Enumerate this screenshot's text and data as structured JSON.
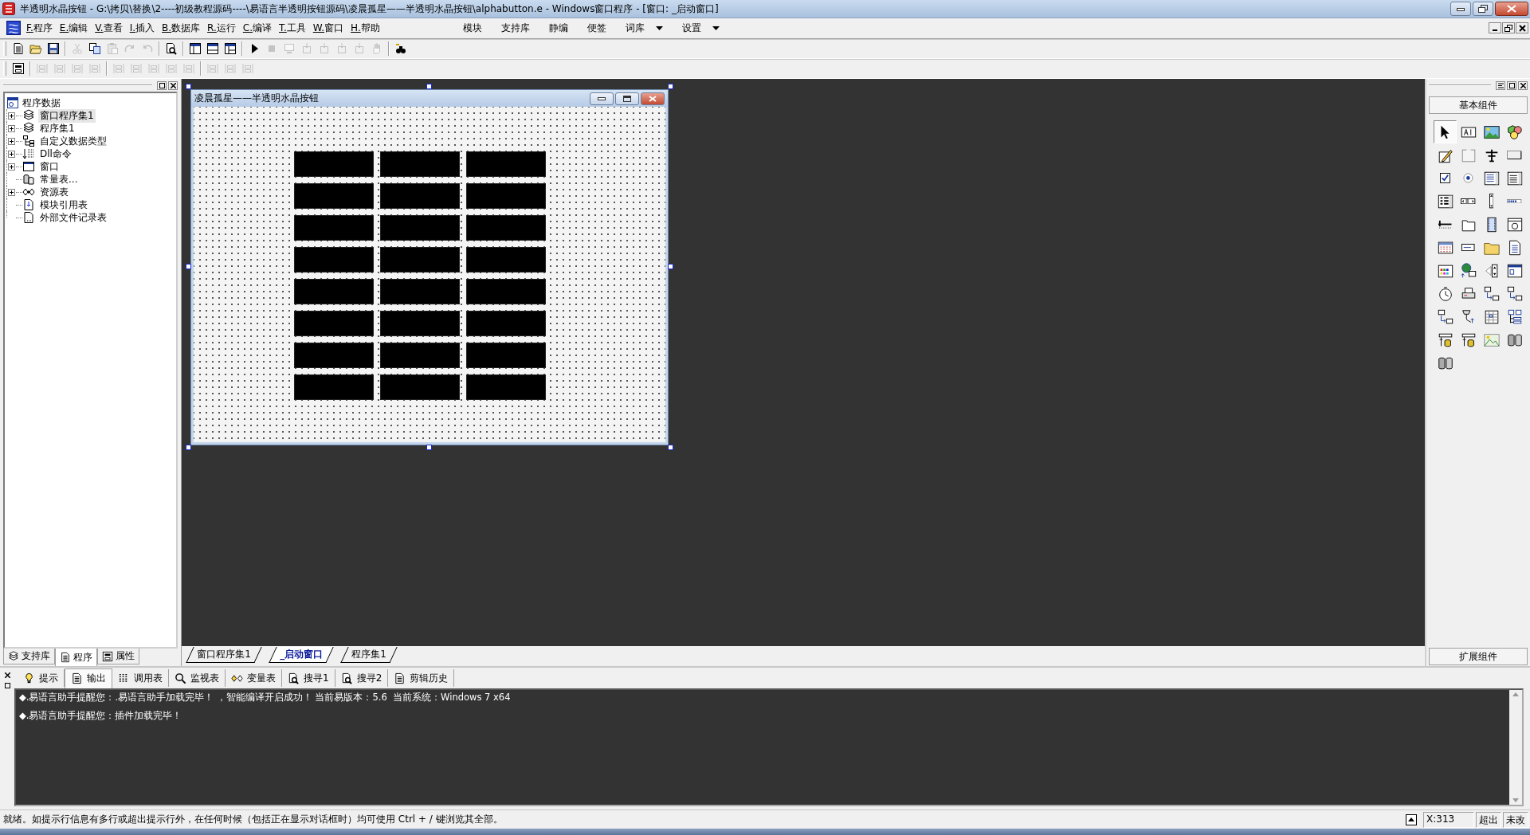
{
  "window": {
    "title": "半透明水晶按钮 - G:\\拷贝\\替换\\2----初级教程源码----\\易语言半透明按钮源码\\凌晨孤星——半透明水晶按钮\\alphabutton.e - Windows窗口程序 - [窗口: _启动窗口]"
  },
  "menu": [
    {
      "label": "F.程序"
    },
    {
      "label": "E.编辑"
    },
    {
      "label": "V.查看"
    },
    {
      "label": "I.插入"
    },
    {
      "label": "B.数据库"
    },
    {
      "label": "R.运行"
    },
    {
      "label": "C.编译"
    },
    {
      "label": "T.工具"
    },
    {
      "label": "W.窗口"
    },
    {
      "label": "H.帮助"
    }
  ],
  "menu_extra": [
    {
      "label": "模块",
      "dropdown": false
    },
    {
      "label": "支持库",
      "dropdown": false
    },
    {
      "label": "静编",
      "dropdown": false
    },
    {
      "label": "便签",
      "dropdown": false
    },
    {
      "label": "词库",
      "dropdown": true
    },
    {
      "label": "设置",
      "dropdown": true
    }
  ],
  "toolbars": [
    [
      [
        {
          "kind": "new",
          "disabled": false
        },
        {
          "kind": "open",
          "disabled": false
        },
        {
          "kind": "save",
          "disabled": false
        }
      ],
      [
        {
          "kind": "cut",
          "disabled": true
        },
        {
          "kind": "copy",
          "disabled": false
        },
        {
          "kind": "paste",
          "disabled": true
        },
        {
          "kind": "redo",
          "disabled": true
        },
        {
          "kind": "undo",
          "disabled": true
        }
      ],
      [
        {
          "kind": "find",
          "disabled": false
        }
      ],
      [
        {
          "kind": "pane1",
          "disabled": false
        },
        {
          "kind": "pane2",
          "disabled": false
        },
        {
          "kind": "pane3",
          "disabled": false
        }
      ],
      [
        {
          "kind": "run",
          "disabled": false
        },
        {
          "kind": "stop",
          "disabled": true
        },
        {
          "kind": "debug",
          "disabled": true
        },
        {
          "kind": "step",
          "disabled": true
        },
        {
          "kind": "step",
          "disabled": true
        },
        {
          "kind": "step",
          "disabled": true
        },
        {
          "kind": "step",
          "disabled": true
        },
        {
          "kind": "hand",
          "disabled": true
        }
      ],
      [
        {
          "kind": "help",
          "disabled": false
        }
      ]
    ],
    [
      [
        {
          "kind": "form",
          "disabled": false
        }
      ],
      [
        {
          "kind": "align",
          "disabled": true
        },
        {
          "kind": "align",
          "disabled": true
        },
        {
          "kind": "align",
          "disabled": true
        },
        {
          "kind": "align",
          "disabled": true
        }
      ],
      [
        {
          "kind": "align",
          "disabled": true
        },
        {
          "kind": "align",
          "disabled": true
        },
        {
          "kind": "align",
          "disabled": true
        },
        {
          "kind": "align",
          "disabled": true
        },
        {
          "kind": "align",
          "disabled": true
        }
      ],
      [
        {
          "kind": "align",
          "disabled": true
        },
        {
          "kind": "align",
          "disabled": true
        },
        {
          "kind": "align",
          "disabled": true
        }
      ]
    ]
  ],
  "tree": {
    "label": "程序数据",
    "kind": "data",
    "children": [
      {
        "label": "窗口程序集1",
        "kind": "stack",
        "expander": true,
        "selected": true
      },
      {
        "label": "程序集1",
        "kind": "stack",
        "expander": true,
        "selected": false
      },
      {
        "label": "自定义数据类型",
        "kind": "types",
        "expander": true,
        "selected": false
      },
      {
        "label": "Dll命令",
        "kind": "dll",
        "expander": true,
        "selected": false
      },
      {
        "label": "窗口",
        "kind": "window",
        "expander": true,
        "selected": false
      },
      {
        "label": "常量表...",
        "kind": "constants",
        "expander": false,
        "selected": false
      },
      {
        "label": "资源表",
        "kind": "resources",
        "expander": true,
        "selected": false
      },
      {
        "label": "模块引用表",
        "kind": "module",
        "expander": false,
        "selected": false
      },
      {
        "label": "外部文件记录表",
        "kind": "file",
        "expander": false,
        "selected": false
      }
    ]
  },
  "left_tabs": [
    {
      "label": "支持库",
      "kind": "stack",
      "selected": false
    },
    {
      "label": "程序",
      "kind": "doc",
      "selected": true
    },
    {
      "label": "属性",
      "kind": "form",
      "selected": false
    }
  ],
  "form": {
    "title": "凌晨孤星——半透明水晶按钮",
    "buttons": [
      {
        "kind": "alpha-button"
      },
      {
        "kind": "alpha-button"
      },
      {
        "kind": "alpha-button"
      },
      {
        "kind": "alpha-button"
      },
      {
        "kind": "alpha-button"
      },
      {
        "kind": "alpha-button"
      },
      {
        "kind": "alpha-button"
      },
      {
        "kind": "alpha-button"
      },
      {
        "kind": "alpha-button"
      },
      {
        "kind": "alpha-button"
      },
      {
        "kind": "alpha-button"
      },
      {
        "kind": "alpha-button"
      },
      {
        "kind": "alpha-button"
      },
      {
        "kind": "alpha-button"
      },
      {
        "kind": "alpha-button"
      },
      {
        "kind": "alpha-button"
      },
      {
        "kind": "alpha-button"
      },
      {
        "kind": "alpha-button"
      },
      {
        "kind": "alpha-button"
      },
      {
        "kind": "alpha-button"
      },
      {
        "kind": "alpha-button"
      },
      {
        "kind": "alpha-button"
      },
      {
        "kind": "alpha-button"
      },
      {
        "kind": "alpha-button"
      }
    ]
  },
  "designer_tabs": [
    {
      "label": "窗口程序集1",
      "selected": false
    },
    {
      "label": "_启动窗口",
      "selected": true
    },
    {
      "label": "程序集1",
      "selected": false
    }
  ],
  "toolbox": {
    "header": "基本组件",
    "footer": "扩展组件",
    "items": [
      {
        "kind": "pointer",
        "selected": true
      },
      {
        "kind": "label",
        "selected": false
      },
      {
        "kind": "picture",
        "selected": false
      },
      {
        "kind": "shapes",
        "selected": false
      },
      {
        "kind": "editbox",
        "selected": false
      },
      {
        "kind": "frame",
        "selected": false
      },
      {
        "kind": "text",
        "selected": false
      },
      {
        "kind": "button",
        "selected": false
      },
      {
        "kind": "checkbox",
        "selected": false
      },
      {
        "kind": "radio",
        "selected": false
      },
      {
        "kind": "combo",
        "selected": false
      },
      {
        "kind": "listbox",
        "selected": false
      },
      {
        "kind": "checklist",
        "selected": false
      },
      {
        "kind": "hscroll",
        "selected": false
      },
      {
        "kind": "vscroll",
        "selected": false
      },
      {
        "kind": "progress",
        "selected": false
      },
      {
        "kind": "slider",
        "selected": false
      },
      {
        "kind": "tabs",
        "selected": false
      },
      {
        "kind": "video",
        "selected": false
      },
      {
        "kind": "animation",
        "selected": false
      },
      {
        "kind": "calendar",
        "selected": false
      },
      {
        "kind": "textbar",
        "selected": false
      },
      {
        "kind": "folder",
        "selected": false
      },
      {
        "kind": "document",
        "selected": false
      },
      {
        "kind": "palette",
        "selected": false
      },
      {
        "kind": "network",
        "selected": false
      },
      {
        "kind": "spinner",
        "selected": false
      },
      {
        "kind": "panel",
        "selected": false
      },
      {
        "kind": "timer",
        "selected": false
      },
      {
        "kind": "printer",
        "selected": false
      },
      {
        "kind": "transfer",
        "selected": false
      },
      {
        "kind": "transfer",
        "selected": false
      },
      {
        "kind": "transfer",
        "selected": false
      },
      {
        "kind": "serial",
        "selected": false
      },
      {
        "kind": "grid",
        "selected": false
      },
      {
        "kind": "tree",
        "selected": false
      },
      {
        "kind": "db",
        "selected": false
      },
      {
        "kind": "db",
        "selected": false
      },
      {
        "kind": "chart",
        "selected": false
      },
      {
        "kind": "odbc",
        "selected": false
      },
      {
        "kind": "odbc",
        "selected": false
      }
    ]
  },
  "output_tabs": [
    {
      "label": "提示",
      "kind": "hint",
      "selected": false
    },
    {
      "label": "输出",
      "kind": "doc",
      "selected": true
    },
    {
      "label": "调用表",
      "kind": "calls",
      "selected": false
    },
    {
      "label": "监视表",
      "kind": "watch",
      "selected": false
    },
    {
      "label": "变量表",
      "kind": "vars",
      "selected": false
    },
    {
      "label": "搜寻1",
      "kind": "find",
      "selected": false
    },
    {
      "label": "搜寻2",
      "kind": "find",
      "selected": false
    },
    {
      "label": "剪辑历史",
      "kind": "doc",
      "selected": false
    }
  ],
  "output_lines": [
    "◆.易语言助手提醒您：.易语言助手加载完毕！ ，智能编译开启成功！ 当前易版本：5.6  当前系统：Windows 7 x64",
    "◆.易语言助手提醒您：插件加载完毕！"
  ],
  "status_bar": {
    "message": "就绪。如提示行信息有多行或超出提示行外，在任何时候（包括正在显示对话框时）均可使用 Ctrl + / 键浏览其全部。",
    "position": "X:313",
    "overflow": "超出",
    "modified": "未改"
  }
}
